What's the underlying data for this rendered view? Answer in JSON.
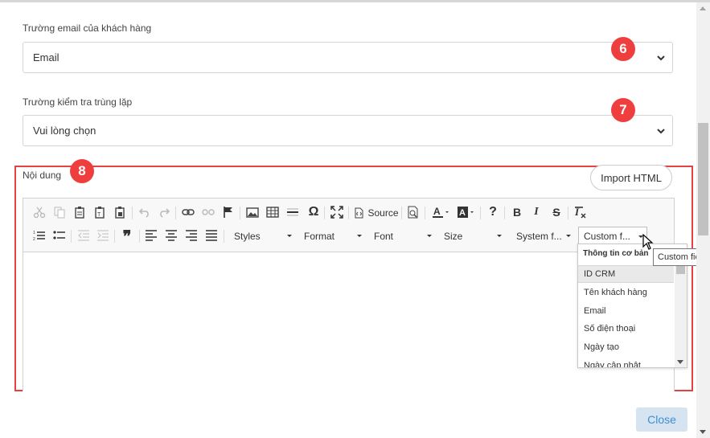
{
  "form": {
    "email_field": {
      "label": "Trường email của khách hàng",
      "value": "Email"
    },
    "dedupe_field": {
      "label": "Trường kiểm tra trùng lặp",
      "value": "Vui lòng chọn"
    },
    "content_label": "Nội dung",
    "import_html_label": "Import HTML"
  },
  "badges": {
    "b6": "6",
    "b7": "7",
    "b8": "8"
  },
  "toolbar": {
    "source_label": "Source",
    "help_label": "?",
    "bold_label": "B",
    "italic_label": "I",
    "strike_label": "S",
    "omega_label": "Ω",
    "styles_label": "Styles",
    "format_label": "Format",
    "font_label": "Font",
    "size_label": "Size",
    "system_fields_label": "System f...",
    "custom_fields_label": "Custom f..."
  },
  "custom_fields_panel": {
    "group_title": "Thông tin cơ bản",
    "items": [
      "ID CRM",
      "Tên khách hàng",
      "Email",
      "Số điện thoại",
      "Ngày tạo",
      "Ngày cập nhật"
    ]
  },
  "tooltip": {
    "text": "Custom fields"
  },
  "footer": {
    "close_label": "Close"
  },
  "colors": {
    "accent": "#3e8ed0",
    "badge": "#ef3e3e",
    "highlight_frame": "#e34242",
    "close_bg": "#d6e4f2"
  }
}
